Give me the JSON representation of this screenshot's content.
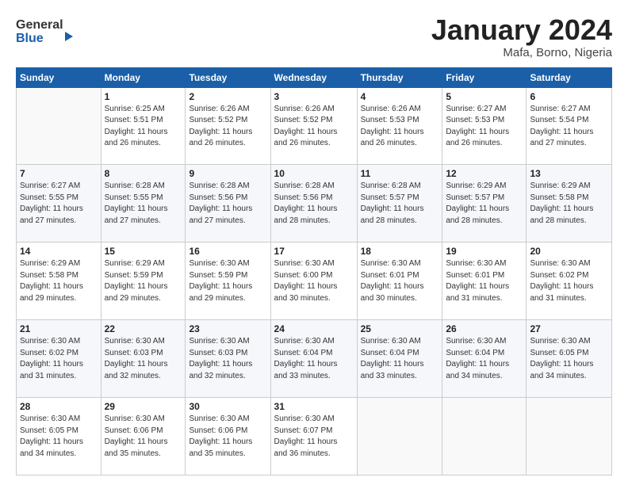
{
  "logo": {
    "line1": "General",
    "line2": "Blue"
  },
  "header": {
    "month": "January 2024",
    "location": "Mafa, Borno, Nigeria"
  },
  "weekdays": [
    "Sunday",
    "Monday",
    "Tuesday",
    "Wednesday",
    "Thursday",
    "Friday",
    "Saturday"
  ],
  "weeks": [
    [
      {
        "day": "",
        "info": ""
      },
      {
        "day": "1",
        "info": "Sunrise: 6:25 AM\nSunset: 5:51 PM\nDaylight: 11 hours\nand 26 minutes."
      },
      {
        "day": "2",
        "info": "Sunrise: 6:26 AM\nSunset: 5:52 PM\nDaylight: 11 hours\nand 26 minutes."
      },
      {
        "day": "3",
        "info": "Sunrise: 6:26 AM\nSunset: 5:52 PM\nDaylight: 11 hours\nand 26 minutes."
      },
      {
        "day": "4",
        "info": "Sunrise: 6:26 AM\nSunset: 5:53 PM\nDaylight: 11 hours\nand 26 minutes."
      },
      {
        "day": "5",
        "info": "Sunrise: 6:27 AM\nSunset: 5:53 PM\nDaylight: 11 hours\nand 26 minutes."
      },
      {
        "day": "6",
        "info": "Sunrise: 6:27 AM\nSunset: 5:54 PM\nDaylight: 11 hours\nand 27 minutes."
      }
    ],
    [
      {
        "day": "7",
        "info": "Sunrise: 6:27 AM\nSunset: 5:55 PM\nDaylight: 11 hours\nand 27 minutes."
      },
      {
        "day": "8",
        "info": "Sunrise: 6:28 AM\nSunset: 5:55 PM\nDaylight: 11 hours\nand 27 minutes."
      },
      {
        "day": "9",
        "info": "Sunrise: 6:28 AM\nSunset: 5:56 PM\nDaylight: 11 hours\nand 27 minutes."
      },
      {
        "day": "10",
        "info": "Sunrise: 6:28 AM\nSunset: 5:56 PM\nDaylight: 11 hours\nand 28 minutes."
      },
      {
        "day": "11",
        "info": "Sunrise: 6:28 AM\nSunset: 5:57 PM\nDaylight: 11 hours\nand 28 minutes."
      },
      {
        "day": "12",
        "info": "Sunrise: 6:29 AM\nSunset: 5:57 PM\nDaylight: 11 hours\nand 28 minutes."
      },
      {
        "day": "13",
        "info": "Sunrise: 6:29 AM\nSunset: 5:58 PM\nDaylight: 11 hours\nand 28 minutes."
      }
    ],
    [
      {
        "day": "14",
        "info": "Sunrise: 6:29 AM\nSunset: 5:58 PM\nDaylight: 11 hours\nand 29 minutes."
      },
      {
        "day": "15",
        "info": "Sunrise: 6:29 AM\nSunset: 5:59 PM\nDaylight: 11 hours\nand 29 minutes."
      },
      {
        "day": "16",
        "info": "Sunrise: 6:30 AM\nSunset: 5:59 PM\nDaylight: 11 hours\nand 29 minutes."
      },
      {
        "day": "17",
        "info": "Sunrise: 6:30 AM\nSunset: 6:00 PM\nDaylight: 11 hours\nand 30 minutes."
      },
      {
        "day": "18",
        "info": "Sunrise: 6:30 AM\nSunset: 6:01 PM\nDaylight: 11 hours\nand 30 minutes."
      },
      {
        "day": "19",
        "info": "Sunrise: 6:30 AM\nSunset: 6:01 PM\nDaylight: 11 hours\nand 31 minutes."
      },
      {
        "day": "20",
        "info": "Sunrise: 6:30 AM\nSunset: 6:02 PM\nDaylight: 11 hours\nand 31 minutes."
      }
    ],
    [
      {
        "day": "21",
        "info": "Sunrise: 6:30 AM\nSunset: 6:02 PM\nDaylight: 11 hours\nand 31 minutes."
      },
      {
        "day": "22",
        "info": "Sunrise: 6:30 AM\nSunset: 6:03 PM\nDaylight: 11 hours\nand 32 minutes."
      },
      {
        "day": "23",
        "info": "Sunrise: 6:30 AM\nSunset: 6:03 PM\nDaylight: 11 hours\nand 32 minutes."
      },
      {
        "day": "24",
        "info": "Sunrise: 6:30 AM\nSunset: 6:04 PM\nDaylight: 11 hours\nand 33 minutes."
      },
      {
        "day": "25",
        "info": "Sunrise: 6:30 AM\nSunset: 6:04 PM\nDaylight: 11 hours\nand 33 minutes."
      },
      {
        "day": "26",
        "info": "Sunrise: 6:30 AM\nSunset: 6:04 PM\nDaylight: 11 hours\nand 34 minutes."
      },
      {
        "day": "27",
        "info": "Sunrise: 6:30 AM\nSunset: 6:05 PM\nDaylight: 11 hours\nand 34 minutes."
      }
    ],
    [
      {
        "day": "28",
        "info": "Sunrise: 6:30 AM\nSunset: 6:05 PM\nDaylight: 11 hours\nand 34 minutes."
      },
      {
        "day": "29",
        "info": "Sunrise: 6:30 AM\nSunset: 6:06 PM\nDaylight: 11 hours\nand 35 minutes."
      },
      {
        "day": "30",
        "info": "Sunrise: 6:30 AM\nSunset: 6:06 PM\nDaylight: 11 hours\nand 35 minutes."
      },
      {
        "day": "31",
        "info": "Sunrise: 6:30 AM\nSunset: 6:07 PM\nDaylight: 11 hours\nand 36 minutes."
      },
      {
        "day": "",
        "info": ""
      },
      {
        "day": "",
        "info": ""
      },
      {
        "day": "",
        "info": ""
      }
    ]
  ]
}
